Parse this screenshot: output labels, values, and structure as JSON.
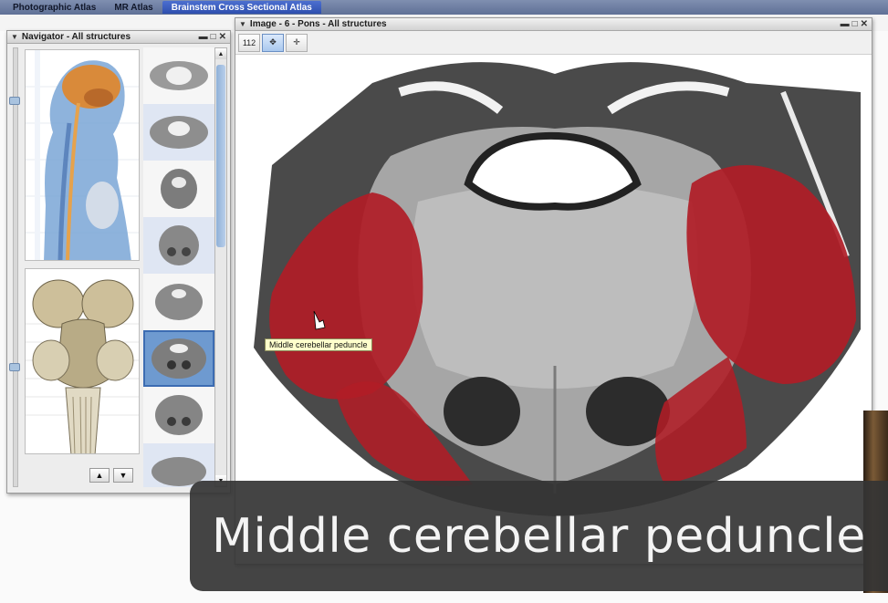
{
  "tabs": [
    {
      "label": "Photographic Atlas"
    },
    {
      "label": "MR Atlas"
    },
    {
      "label": "Brainstem Cross Sectional Atlas"
    }
  ],
  "navigator": {
    "title": "Navigator - All structures",
    "thumbnails_count_visible": 8,
    "selected_thumbnail": 6
  },
  "image_window": {
    "title": "Image - 6 - Pons - All structures",
    "zoom_label": "112",
    "tooltip": "Middle cerebellar peduncle"
  },
  "caption": {
    "text": "Middle cerebellar peduncle"
  },
  "colors": {
    "highlight_red": "#b01c26",
    "tab_active": "#3a5cc0",
    "selection_blue": "#6e9ad0"
  },
  "icons": [
    "zoom-icon",
    "pan-icon",
    "crosshair-icon",
    "arrow-up-icon",
    "arrow-down-icon",
    "cursor-hand-icon"
  ]
}
